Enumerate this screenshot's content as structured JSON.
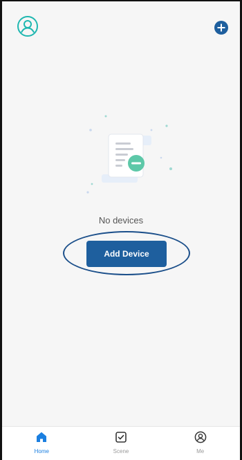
{
  "header": {
    "avatar_icon": "user-circle-icon",
    "add_icon": "plus-circle-icon",
    "accent_color": "#1b4f8a"
  },
  "empty_state": {
    "illustration": "empty-document-icon",
    "message": "No devices",
    "action_label": "Add Device",
    "button_color": "#1e5f9e",
    "highlight_color": "#1b4f8a"
  },
  "bottom_nav": {
    "active_color": "#1b7fe0",
    "items": [
      {
        "label": "Home",
        "icon": "home-icon",
        "active": true
      },
      {
        "label": "Scene",
        "icon": "checkbox-icon",
        "active": false
      },
      {
        "label": "Me",
        "icon": "user-circle-icon",
        "active": false
      }
    ]
  }
}
